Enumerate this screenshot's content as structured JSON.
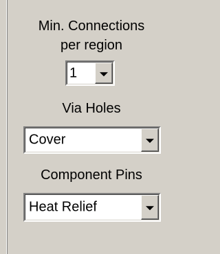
{
  "min_connections": {
    "label_line1": "Min. Connections",
    "label_line2": "per region",
    "value": "1"
  },
  "via_holes": {
    "label": "Via Holes",
    "value": "Cover"
  },
  "component_pins": {
    "label": "Component Pins",
    "value": "Heat Relief"
  },
  "icons": {
    "dropdown": "chevron-down-icon"
  },
  "colors": {
    "background": "#d4d0c8",
    "field": "#ffffff",
    "text": "#000000"
  }
}
